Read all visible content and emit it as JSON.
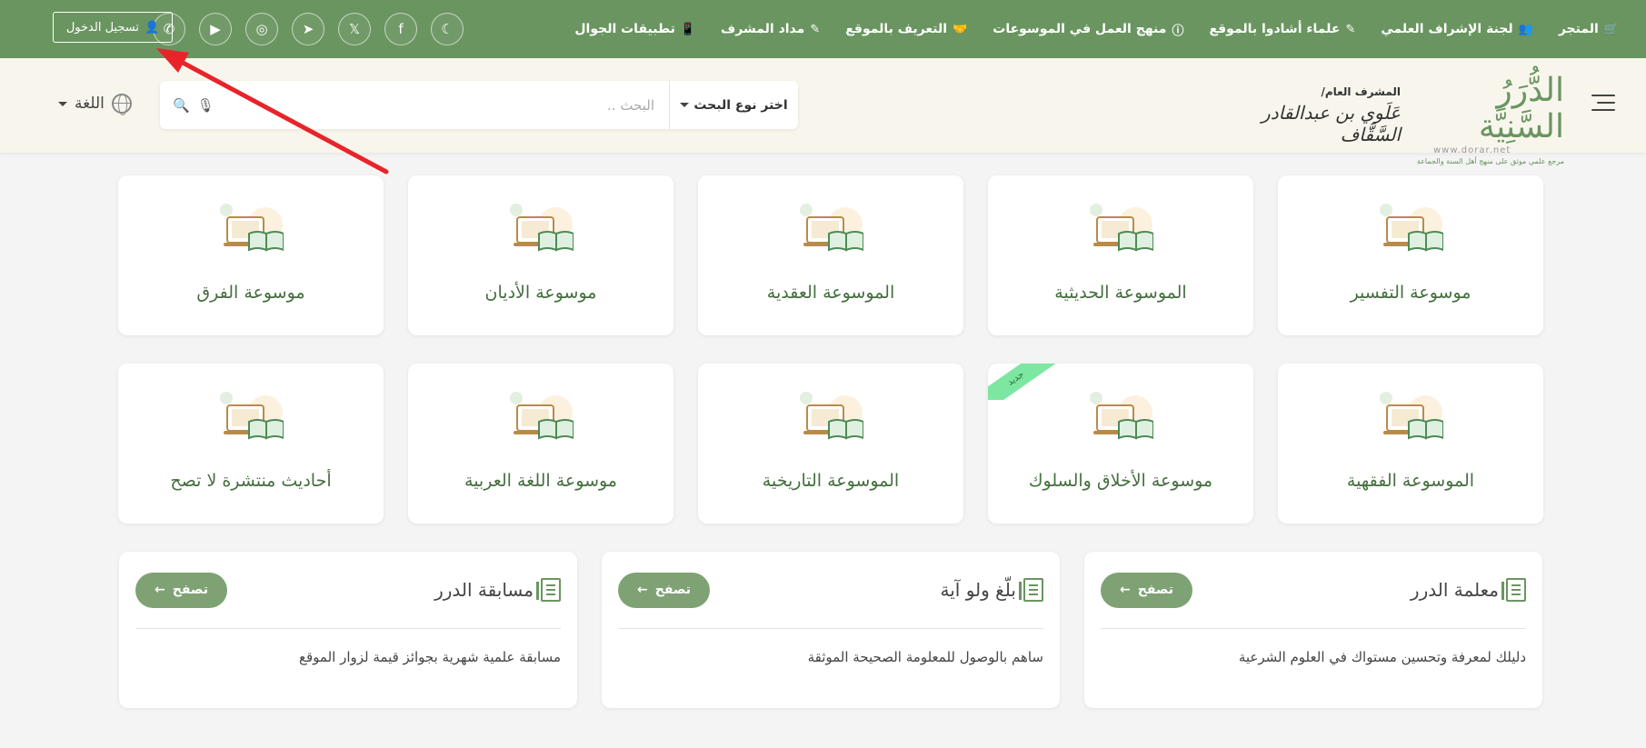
{
  "topbar": {
    "nav": [
      {
        "label": "المتجر",
        "icon": "cart-icon"
      },
      {
        "label": "لجنة الإشراف العلمي",
        "icon": "users-icon"
      },
      {
        "label": "علماء أشادوا بالموقع",
        "icon": "edit-icon"
      },
      {
        "label": "منهج العمل في الموسوعات",
        "icon": "info-icon"
      },
      {
        "label": "التعريف بالموقع",
        "icon": "handshake-icon"
      },
      {
        "label": "مداد المشرف",
        "icon": "edit-icon"
      },
      {
        "label": "تطبيقات الجوال",
        "icon": "mobile-icon"
      }
    ],
    "socials": [
      "moon-icon",
      "facebook-icon",
      "x-icon",
      "telegram-icon",
      "instagram-icon",
      "youtube-icon",
      "whatsapp-icon"
    ],
    "login_label": "تسجيل الدخول"
  },
  "header": {
    "logo_title": "الدُّرَرُ السَّنِيَّة",
    "logo_url": "www.dorar.net",
    "logo_tagline": "مرجع علمي موثق على منهج أهل السنة والجماعة",
    "supervisor_label": "المشرف العام/",
    "supervisor_name": "عَلَوي بن عبدالقادر السَّقَّاف",
    "search_type_label": "اختر نوع البحث",
    "search_placeholder": "البحث ..",
    "language_label": "اللغة"
  },
  "encyclopedias": [
    {
      "title": "موسوعة التفسير",
      "is_new": false
    },
    {
      "title": "الموسوعة الحديثية",
      "is_new": false
    },
    {
      "title": "الموسوعة العقدية",
      "is_new": false
    },
    {
      "title": "موسوعة الأديان",
      "is_new": false
    },
    {
      "title": "موسوعة الفرق",
      "is_new": false
    },
    {
      "title": "الموسوعة الفقهية",
      "is_new": false
    },
    {
      "title": "موسوعة الأخلاق والسلوك",
      "is_new": true
    },
    {
      "title": "الموسوعة التاريخية",
      "is_new": false
    },
    {
      "title": "موسوعة اللغة العربية",
      "is_new": false
    },
    {
      "title": "أحاديث منتشرة لا تصح",
      "is_new": false
    }
  ],
  "new_badge": "جديد",
  "services": [
    {
      "title": "معلمة الدرر",
      "description": "دليلك لمعرفة وتحسين مستواك في العلوم الشرعية",
      "button": "تصفح"
    },
    {
      "title": "بلّغ ولو آية",
      "description": "ساهم بالوصول للمعلومة الصحيحة الموثقة",
      "button": "تصفح"
    },
    {
      "title": "مسابقة الدرر",
      "description": "مسابقة علمية شهرية بجوائز قيمة لزوار الموقع",
      "button": "تصفح"
    }
  ],
  "colors": {
    "brand_green": "#6a9560",
    "button_green": "#7fa275",
    "new_badge": "#7de7a1",
    "annotation_arrow": "#e8242a"
  }
}
